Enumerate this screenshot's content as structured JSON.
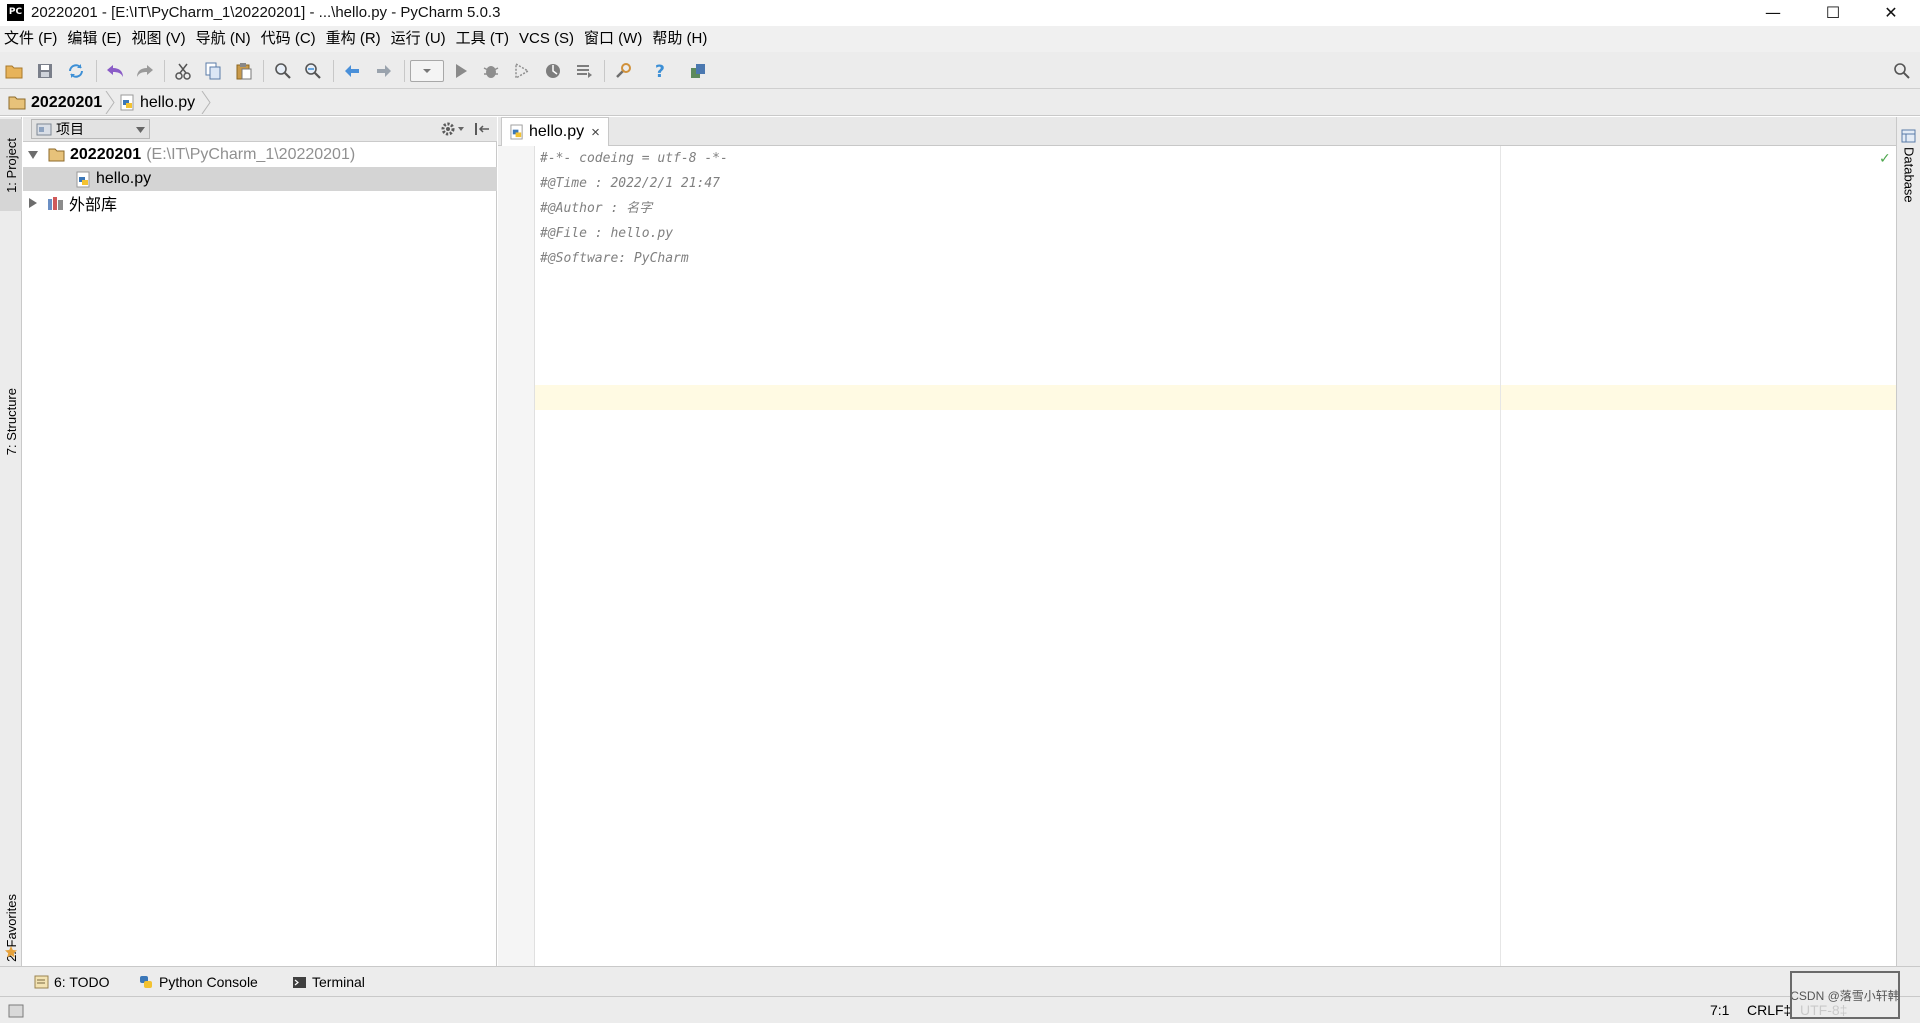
{
  "window": {
    "title": "20220201 - [E:\\IT\\PyCharm_1\\20220201] - ...\\hello.py - PyCharm 5.0.3",
    "app_icon_text": "PC",
    "minimize": "—",
    "maximize": "☐",
    "close": "✕"
  },
  "menu": [
    {
      "label": "文件 (F)"
    },
    {
      "label": "编辑 (E)"
    },
    {
      "label": "视图 (V)"
    },
    {
      "label": "导航 (N)"
    },
    {
      "label": "代码 (C)"
    },
    {
      "label": "重构 (R)"
    },
    {
      "label": "运行 (U)"
    },
    {
      "label": "工具 (T)"
    },
    {
      "label": "VCS (S)"
    },
    {
      "label": "窗口 (W)"
    },
    {
      "label": "帮助 (H)"
    }
  ],
  "toolbar": {
    "icons": [
      "open-icon",
      "save-icon",
      "sync-icon",
      "undo-icon",
      "redo-icon",
      "cut-icon",
      "copy-icon",
      "paste-icon",
      "find-icon",
      "replace-icon",
      "back-icon",
      "forward-icon",
      "run-config-dropdown",
      "run-icon",
      "debug-icon",
      "coverage-icon",
      "profile-icon",
      "concurrency-icon",
      "settings-icon",
      "help-icon",
      "vcs-icon"
    ],
    "search_icon": "search-icon"
  },
  "breadcrumb": {
    "project": "20220201",
    "file": "hello.py"
  },
  "left_stripe": {
    "project_tab": "1: Project",
    "structure_tab": "7: Structure",
    "favorites_tab": "2: Favorites"
  },
  "right_stripe": {
    "database_tab": "Database"
  },
  "project_panel": {
    "view_label": "项目",
    "root_name": "20220201",
    "root_path": "(E:\\IT\\PyCharm_1\\20220201)",
    "file_name": "hello.py",
    "external_libs": "外部库"
  },
  "editor": {
    "tab_label": "hello.py",
    "tab_close": "×",
    "lines": [
      "#-*- codeing = utf-8 -*-",
      "#@Time : 2022/2/1 21:47",
      "#@Author : 名字",
      "#@File : hello.py",
      "#@Software: PyCharm",
      "",
      ""
    ],
    "inspection_ok": "✓"
  },
  "bottom_tabs": {
    "todo": "6: TODO",
    "python_console": "Python Console",
    "terminal": "Terminal"
  },
  "status": {
    "caret": "7:1",
    "line_sep": "CRLF‡",
    "encoding": "UTF-8‡",
    "watermark": "CSDN @落雪小轩韩"
  },
  "colors": {
    "caret_line": "#fffae3",
    "comment": "#808080",
    "panel_bg": "#ececec"
  }
}
